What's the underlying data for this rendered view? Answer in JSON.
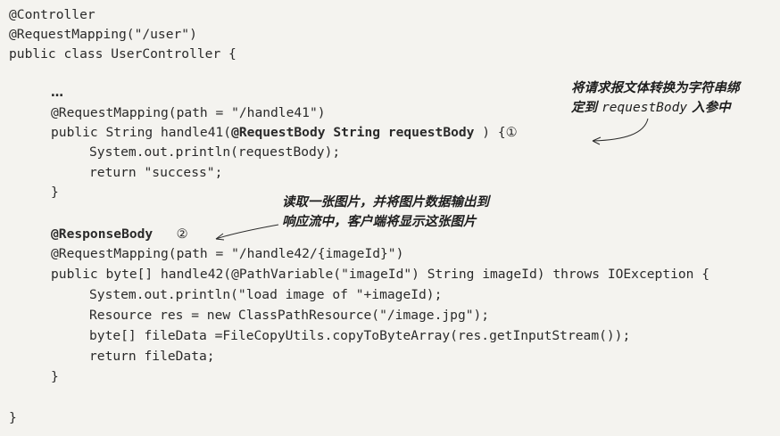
{
  "code": {
    "l1": "@Controller",
    "l2": "@RequestMapping(\"/user\")",
    "l3": "public class UserController {",
    "l4": "…",
    "l5": "@RequestMapping(path = \"/handle41\")",
    "l6_prefix": "public String handle41(",
    "l6_bold": "@RequestBody String requestBody",
    "l6_suffix": " ) {",
    "l6_marker": "①",
    "l7": "System.out.println(requestBody);",
    "l8": "return \"success\";",
    "l9": "}",
    "l10": "@ResponseBody",
    "l10_marker": "②",
    "l11": "@RequestMapping(path = \"/handle42/{imageId}\")",
    "l12": "public byte[] handle42(@PathVariable(\"imageId\") String imageId) throws IOException {",
    "l13": "System.out.println(\"load image of \"+imageId);",
    "l14": "Resource res = new ClassPathResource(\"/image.jpg\");",
    "l15": "byte[] fileData =FileCopyUtils.copyToByteArray(res.getInputStream());",
    "l16": "return fileData;",
    "l17": "}",
    "l18": "}"
  },
  "annotations": {
    "a1_line1": "将请求报文体转换为字符串绑",
    "a1_line2_pre": "定到 ",
    "a1_line2_mono": "requestBody",
    "a1_line2_post": " 入参中",
    "a2_line1": "读取一张图片，并将图片数据输出到",
    "a2_line2": "响应流中，客户端将显示这张图片"
  }
}
